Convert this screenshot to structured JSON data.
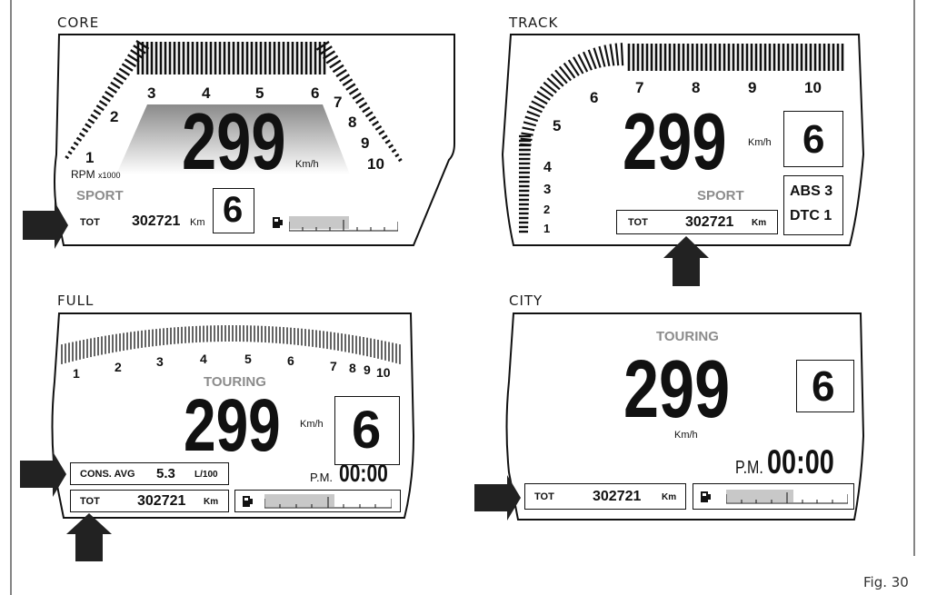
{
  "figure_label": "Fig. 30",
  "panels": {
    "core": {
      "title": "CORE",
      "speed": "299",
      "speed_unit": "Km/h",
      "gear": "6",
      "mode": "SPORT",
      "rpm_label": "RPM",
      "rpm_multiplier": "x1000",
      "rpm_ticks": [
        "1",
        "2",
        "3",
        "4",
        "5",
        "6",
        "7",
        "8",
        "9",
        "10"
      ],
      "odo_label": "TOT",
      "odo_value": "302721",
      "odo_unit": "Km",
      "fuel_icon": "fuel-pump-icon",
      "fuel_level": 0.55
    },
    "track": {
      "title": "TRACK",
      "speed": "299",
      "speed_unit": "Km/h",
      "gear": "6",
      "mode": "SPORT",
      "rpm_ticks": [
        "1",
        "2",
        "3",
        "4",
        "5",
        "6",
        "7",
        "8",
        "9",
        "10"
      ],
      "odo_label": "TOT",
      "odo_value": "302721",
      "odo_unit": "Km",
      "abs": "ABS 3",
      "dtc": "DTC 1"
    },
    "full": {
      "title": "FULL",
      "speed": "299",
      "speed_unit": "Km/h",
      "gear": "6",
      "mode": "TOURING",
      "rpm_ticks": [
        "1",
        "2",
        "3",
        "4",
        "5",
        "6",
        "7",
        "8",
        "9",
        "10"
      ],
      "cons_label": "CONS. AVG",
      "cons_value": "5.3",
      "cons_unit": "L/100",
      "clock_ampm": "P.M.",
      "clock": "00:00",
      "odo_label": "TOT",
      "odo_value": "302721",
      "odo_unit": "Km",
      "fuel_icon": "fuel-pump-icon",
      "fuel_level": 0.55
    },
    "city": {
      "title": "CITY",
      "speed": "299",
      "speed_unit": "Km/h",
      "gear": "6",
      "mode": "TOURING",
      "clock_ampm": "P.M.",
      "clock": "00:00",
      "odo_label": "TOT",
      "odo_value": "302721",
      "odo_unit": "Km",
      "fuel_icon": "fuel-pump-icon",
      "fuel_level": 0.55
    }
  }
}
